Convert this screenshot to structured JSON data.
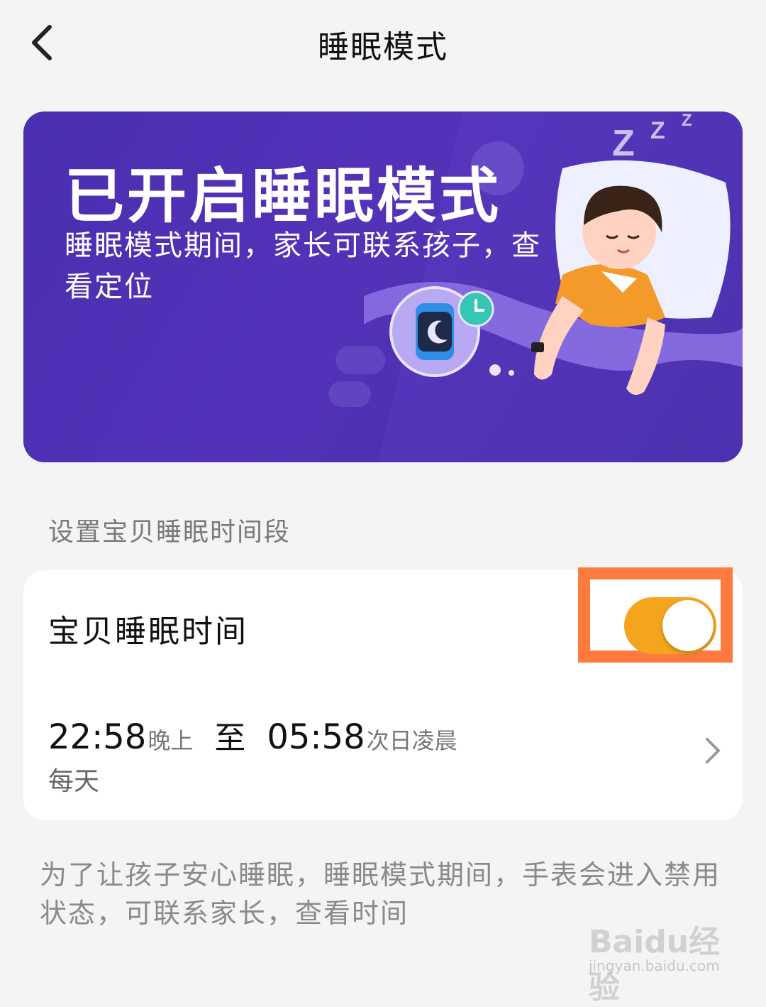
{
  "header": {
    "title": "睡眠模式"
  },
  "banner": {
    "title": "已开启睡眠模式",
    "subtitle": "睡眠模式期间，家长可联系孩子，查看定位"
  },
  "section": {
    "label": "设置宝贝睡眠时间段"
  },
  "sleep_card": {
    "title": "宝贝睡眠时间",
    "toggle_on": true,
    "start_time": "22:58",
    "start_period": "晚上",
    "separator": "至",
    "end_time": "05:58",
    "end_period": "次日凌晨",
    "repeat": "每天"
  },
  "note": "为了让孩子安心睡眠，睡眠模式期间，手表会进入禁用状态，可联系家长，查看时间",
  "watermark": {
    "logo": "Baidu经验",
    "url": "jingyan.baidu.com"
  },
  "colors": {
    "banner": "#4a2fb0",
    "toggle": "#f5a51d",
    "highlight": "#ff7a3c"
  }
}
